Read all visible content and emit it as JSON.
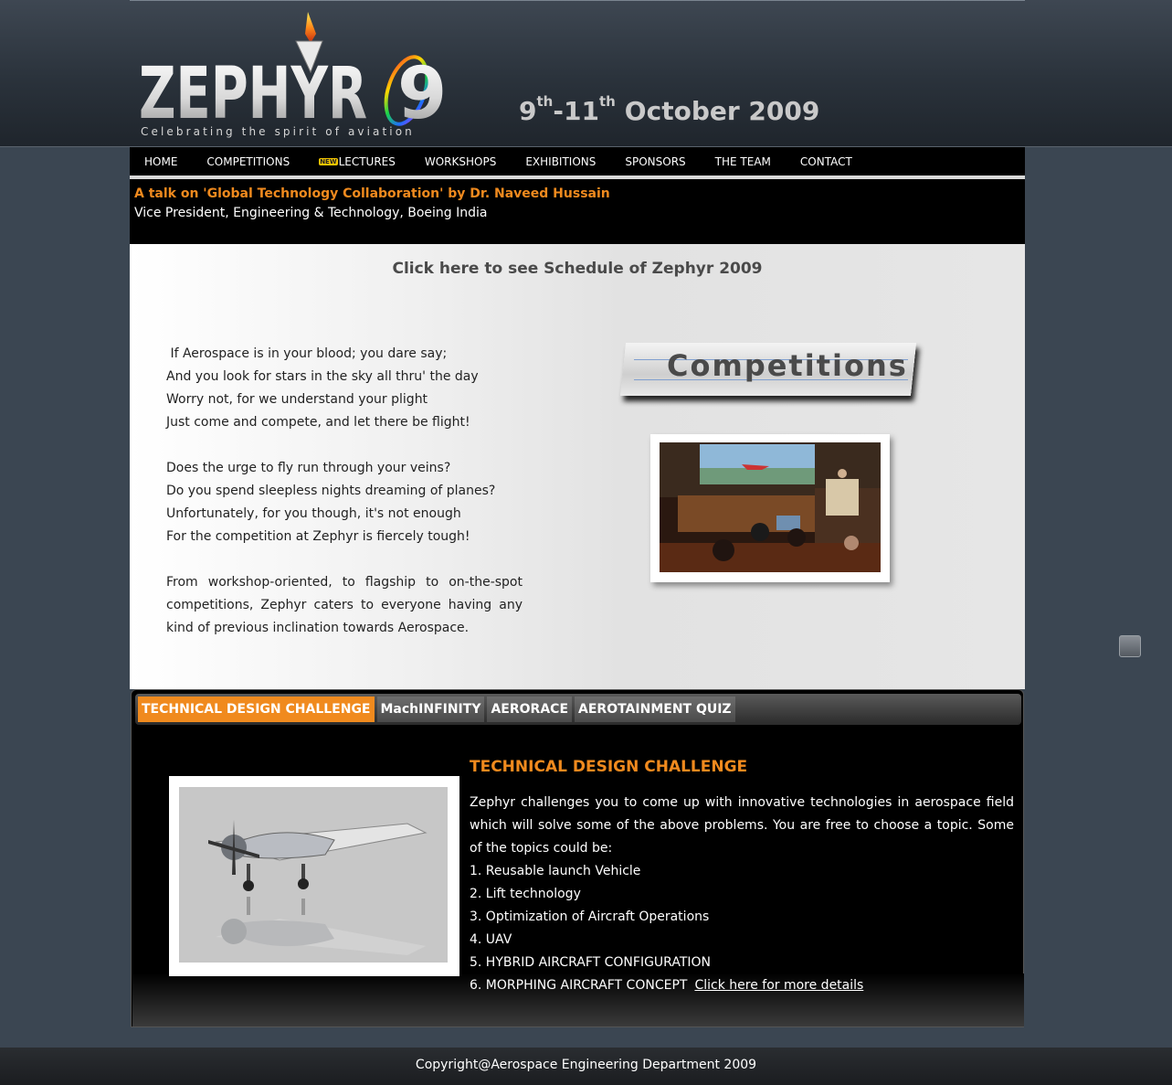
{
  "header": {
    "logo_text": "ZEPHYR 09",
    "tagline": "Celebrating the spirit of aviation",
    "dates": {
      "start_day": "9",
      "start_suffix": "th",
      "separator": "-",
      "end_day": "11",
      "end_suffix": "th",
      "month_year": "October 2009"
    }
  },
  "nav": {
    "items": [
      {
        "label": "HOME"
      },
      {
        "label": "COMPETITIONS"
      },
      {
        "label": "LECTURES",
        "badge": "NEW"
      },
      {
        "label": "WORKSHOPS"
      },
      {
        "label": "EXHIBITIONS"
      },
      {
        "label": "SPONSORS"
      },
      {
        "label": "THE TEAM"
      },
      {
        "label": "CONTACT"
      }
    ]
  },
  "announcement": {
    "title": "A talk on 'Global Technology Collaboration' by Dr. Naveed Hussain",
    "subtitle": "Vice President, Engineering & Technology, Boeing India"
  },
  "schedule_link": "Click here to see Schedule of Zephyr 2009",
  "poem": {
    "lines": [
      " If Aerospace is in your blood; you dare say;",
      "And you look for stars in the sky all thru' the day",
      "Worry not, for we understand your plight",
      "Just come and compete, and let there be flight!",
      "",
      "Does the urge to fly run through your veins?",
      "Do you spend sleepless nights dreaming of planes?",
      "Unfortunately, for you though, it's not enough",
      "For the competition at Zephyr is fiercely tough!"
    ],
    "paragraph": "From workshop-oriented, to flagship to on-the-spot competitions, Zephyr caters to everyone having any kind of previous inclination towards Aerospace."
  },
  "competitions_banner": "Competitions",
  "tabs": [
    {
      "label": "TECHNICAL DESIGN CHALLENGE",
      "active": true
    },
    {
      "label": "MachINFINITY",
      "active": false
    },
    {
      "label": "AERORACE",
      "active": false
    },
    {
      "label": "AEROTAINMENT QUIZ",
      "active": false
    }
  ],
  "design_challenge": {
    "title": "TECHNICAL DESIGN CHALLENGE",
    "intro": "Zephyr challenges you to come up with innovative technologies in aerospace field which will solve some of the above problems. You are free to choose a topic. Some of the topics could be:",
    "topics": [
      "1. Reusable launch Vehicle",
      "2. Lift technology",
      "3. Optimization of Aircraft Operations",
      "4. UAV",
      "5. HYBRID AIRCRAFT CONFIGURATION",
      "6. MORPHING AIRCRAFT CONCEPT"
    ],
    "details_link": "Click here for more details"
  },
  "footer": {
    "copyright": "Copyright@Aerospace Engineering Department 2009"
  },
  "colors": {
    "accent": "#f08a1e",
    "page_bg": "#3b4652",
    "nav_bg": "#000000"
  }
}
